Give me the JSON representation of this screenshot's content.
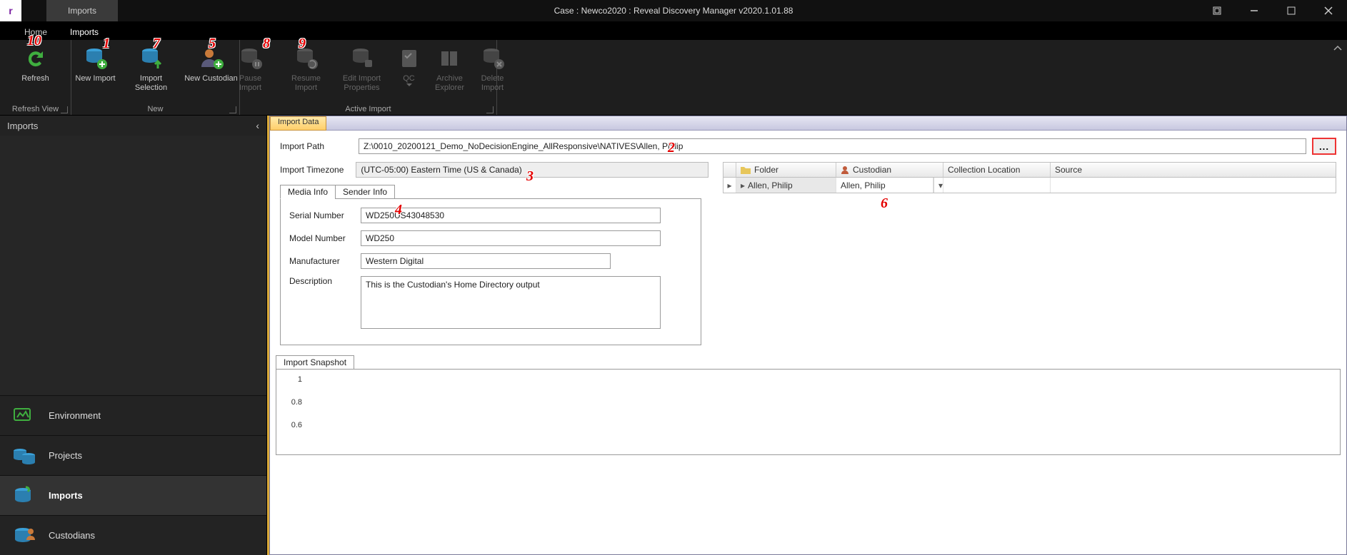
{
  "window": {
    "tab_label": "Imports",
    "title": "Case : Newco2020 : Reveal Discovery Manager  v2020.1.01.88"
  },
  "menu": {
    "home": "Home",
    "imports": "Imports"
  },
  "ribbon": {
    "refresh": "Refresh",
    "new_import": "New Import",
    "import_selection": "Import\nSelection",
    "new_custodian": "New Custodian",
    "pause_import": "Pause\nImport",
    "resume_import": "Resume\nImport",
    "edit_import_properties": "Edit Import\nProperties",
    "qc": "QC",
    "archive_explorer": "Archive\nExplorer",
    "delete_import": "Delete\nImport",
    "group_refresh_view": "Refresh View",
    "group_new": "New",
    "group_active_import": "Active Import"
  },
  "left": {
    "header": "Imports",
    "nav": {
      "environment": "Environment",
      "projects": "Projects",
      "imports": "Imports",
      "custodians": "Custodians"
    }
  },
  "content": {
    "tab": "Import Data",
    "import_path_label": "Import Path",
    "import_path": "Z:\\0010_20200121_Demo_NoDecisionEngine_AllResponsive\\NATIVES\\Allen, Philip",
    "browse": "...",
    "timezone_label": "Import Timezone",
    "timezone": "(UTC-05:00) Eastern Time (US & Canada)",
    "subtabs": {
      "media": "Media Info",
      "sender": "Sender Info"
    },
    "media": {
      "serial_label": "Serial Number",
      "serial": "WD250US43048530",
      "model_label": "Model Number",
      "model": "WD250",
      "manuf_label": "Manufacturer",
      "manuf": "Western Digital",
      "desc_label": "Description",
      "desc": "This is the Custodian's Home Directory output"
    },
    "grid": {
      "h_folder": "Folder",
      "h_custodian": "Custodian",
      "h_collection": "Collection Location",
      "h_source": "Source",
      "row0_folder": "Allen, Philip",
      "row0_custodian": "Allen, Philip"
    },
    "snapshot_label": "Import Snapshot"
  },
  "annotations": {
    "a1": "1",
    "a2": "2",
    "a3": "3",
    "a4": "4",
    "a5": "5",
    "a6": "6",
    "a7": "7",
    "a8": "8",
    "a9": "9",
    "a10": "10"
  },
  "chart_data": {
    "type": "line",
    "title": "Import Snapshot",
    "ylabel": "",
    "xlabel": "",
    "ylim": [
      0,
      1
    ],
    "yticks": [
      1,
      0.8,
      0.6
    ],
    "series": []
  }
}
